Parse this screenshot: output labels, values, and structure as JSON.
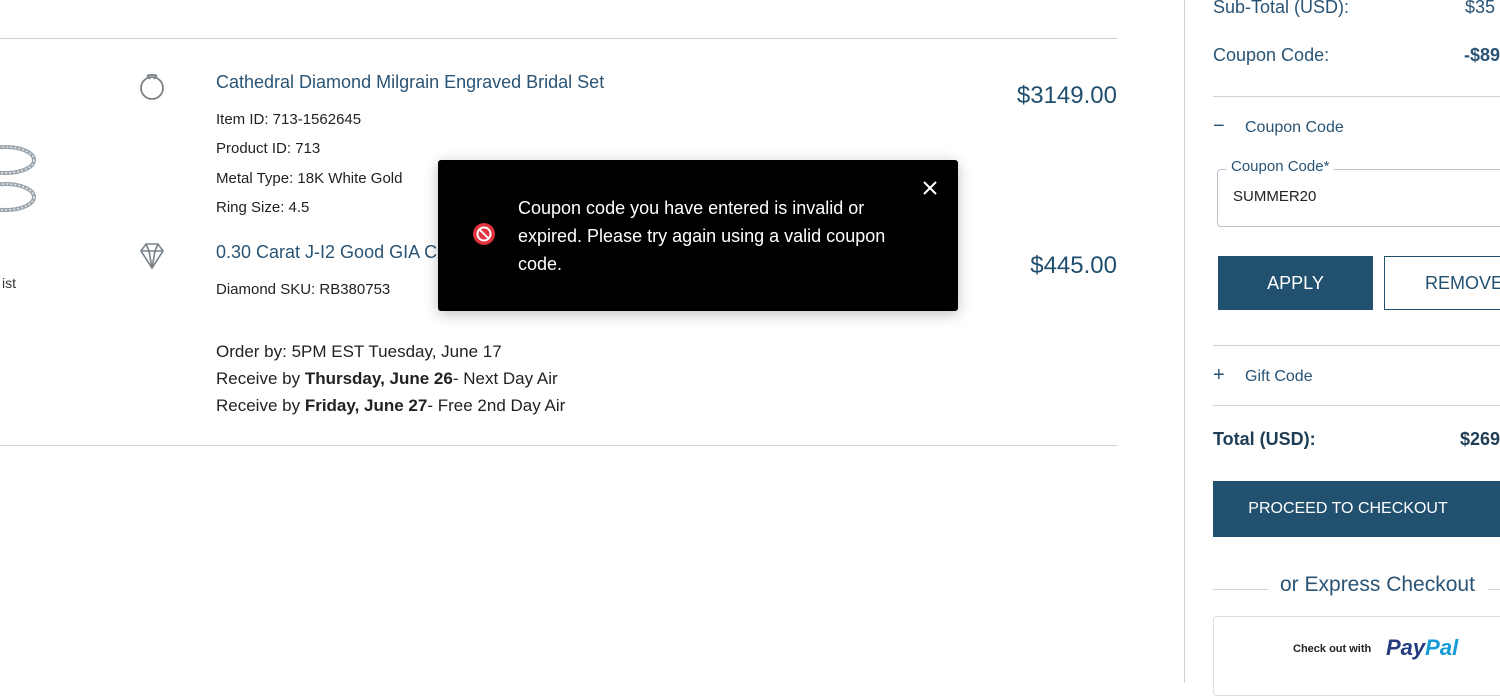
{
  "cart": {
    "items": [
      {
        "title": "Cathedral Diamond Milgrain Engraved Bridal Set",
        "price": "$3149.00",
        "meta": [
          "Item ID: 713-1562645",
          "Product ID: 713",
          "Metal Type: 18K White Gold",
          "Ring Size: 4.5"
        ],
        "icon": "ring-icon"
      },
      {
        "title": "0.30 Carat J-I2 Good GIA C",
        "price": "$445.00",
        "meta": [
          "Diamond SKU: RB380753"
        ],
        "icon": "diamond-icon"
      }
    ],
    "wishlist_fragment": "ist",
    "shipping": {
      "order_by": "Order by: 5PM EST Tuesday, June 17",
      "receive1_prefix": "Receive by ",
      "receive1_bold": "Thursday, June 26",
      "receive1_suffix": "- Next Day Air",
      "receive2_prefix": "Receive by ",
      "receive2_bold": "Friday, June 27",
      "receive2_suffix": "- Free 2nd Day Air"
    }
  },
  "toast": {
    "message": "Coupon code you have entered is invalid or expired. Please try again using a valid coupon code.",
    "icon": "error-prohibited-icon",
    "close_icon": "close-icon"
  },
  "summary": {
    "subtotal_label": "Sub-Total (USD):",
    "subtotal_value": "$35",
    "coupon_label": "Coupon Code:",
    "coupon_value": "-$89",
    "coupon_toggle": {
      "symbol": "−",
      "label": "Coupon Code"
    },
    "coupon_field": {
      "legend": "Coupon Code*",
      "value": "SUMMER20"
    },
    "apply_label": "APPLY",
    "remove_label": "REMOVE",
    "gift_toggle": {
      "symbol": "+",
      "label": "Gift Code"
    },
    "total_label": "Total (USD):",
    "total_value": "$269",
    "checkout_label": "PROCEED TO CHECKOUT",
    "express_label": "or Express Checkout",
    "paypal": {
      "prefix": "Check out with",
      "logo_part1": "Pay",
      "logo_part2": "Pal"
    }
  },
  "colors": {
    "brand_navy": "#22506f",
    "link_blue": "#2a5475",
    "divider": "#c8d3dc",
    "toast_bg": "#000000",
    "error_red": "#e0323f"
  }
}
